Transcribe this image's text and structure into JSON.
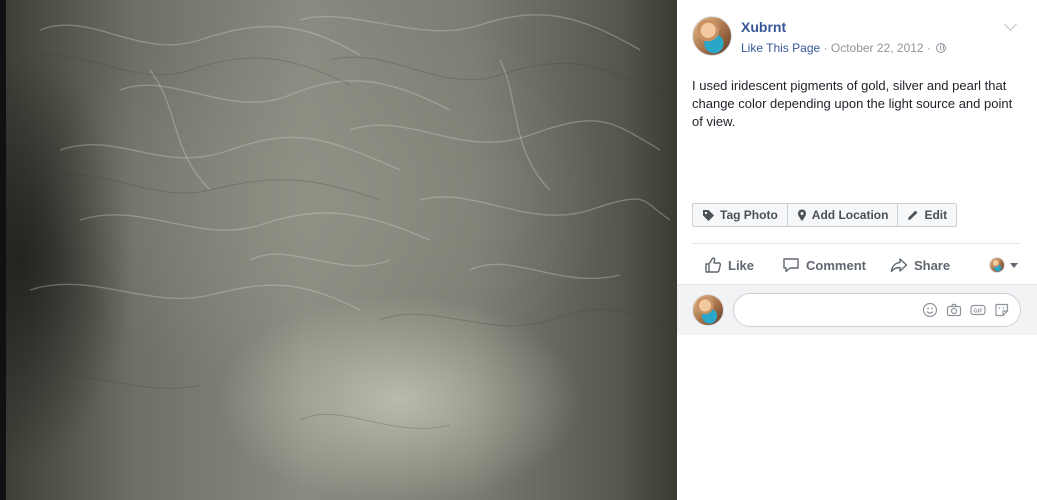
{
  "post": {
    "author": "Xubrnt",
    "like_page": "Like This Page",
    "separator": "·",
    "date": "October 22, 2012",
    "caption": "I used iridescent pigments of gold, silver and pearl that change color depending upon the light source and point of view."
  },
  "photo_actions": {
    "tag_photo": "Tag Photo",
    "add_location": "Add Location",
    "edit": "Edit"
  },
  "ufi": {
    "like": "Like",
    "comment": "Comment",
    "share": "Share"
  },
  "comment_box": {
    "placeholder": ""
  },
  "icons": {
    "privacy": "globe-icon",
    "options": "chevron-down-icon",
    "tag": "tag-icon",
    "location": "map-pin-icon",
    "edit": "pencil-icon",
    "like": "thumbs-up-icon",
    "comment": "speech-bubble-icon",
    "share": "share-arrow-icon",
    "emoji": "smiley-icon",
    "camera": "camera-icon",
    "gif": "gif-icon",
    "sticker": "sticker-icon"
  },
  "colors": {
    "link": "#365899",
    "meta": "#90949c",
    "text": "#1d2129",
    "action_text": "#606770"
  }
}
